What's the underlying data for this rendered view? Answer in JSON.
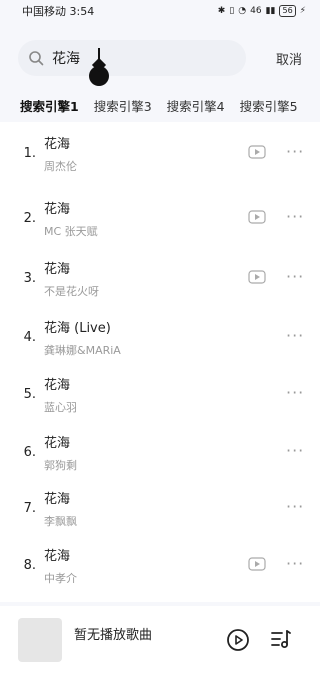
{
  "status": {
    "carrier_time": "中国移动 3:54",
    "signal_text": "46",
    "battery": "56"
  },
  "search": {
    "value": "花海",
    "cancel_label": "取消"
  },
  "tabs": [
    {
      "label": "搜索引擎1"
    },
    {
      "label": "搜索引擎3"
    },
    {
      "label": "搜索引擎4"
    },
    {
      "label": "搜索引擎5"
    }
  ],
  "songs": [
    {
      "num": "1.",
      "title": "花海",
      "artist": "周杰伦"
    },
    {
      "num": "2.",
      "title": "花海",
      "artist": "MC 张天赋"
    },
    {
      "num": "3.",
      "title": "花海",
      "artist": "不是花火呀"
    },
    {
      "num": "4.",
      "title": "花海 (Live)",
      "artist": "龚琳娜&MARiA"
    },
    {
      "num": "5.",
      "title": "花海",
      "artist": "蓝心羽"
    },
    {
      "num": "6.",
      "title": "花海",
      "artist": "郭狗剩"
    },
    {
      "num": "7.",
      "title": "花海",
      "artist": "李飘飘"
    },
    {
      "num": "8.",
      "title": "花海",
      "artist": "中孝介"
    }
  ],
  "player": {
    "now_playing": "暂无播放歌曲"
  },
  "icons": {
    "search": "search-icon",
    "video": "video-icon",
    "more": "more-icon",
    "play": "play-icon",
    "playlist": "playlist-icon"
  },
  "colors": {
    "background": "#f6f7fb",
    "list_background": "#ffffff",
    "text": "#222222",
    "subtext": "#9a9a9a"
  }
}
